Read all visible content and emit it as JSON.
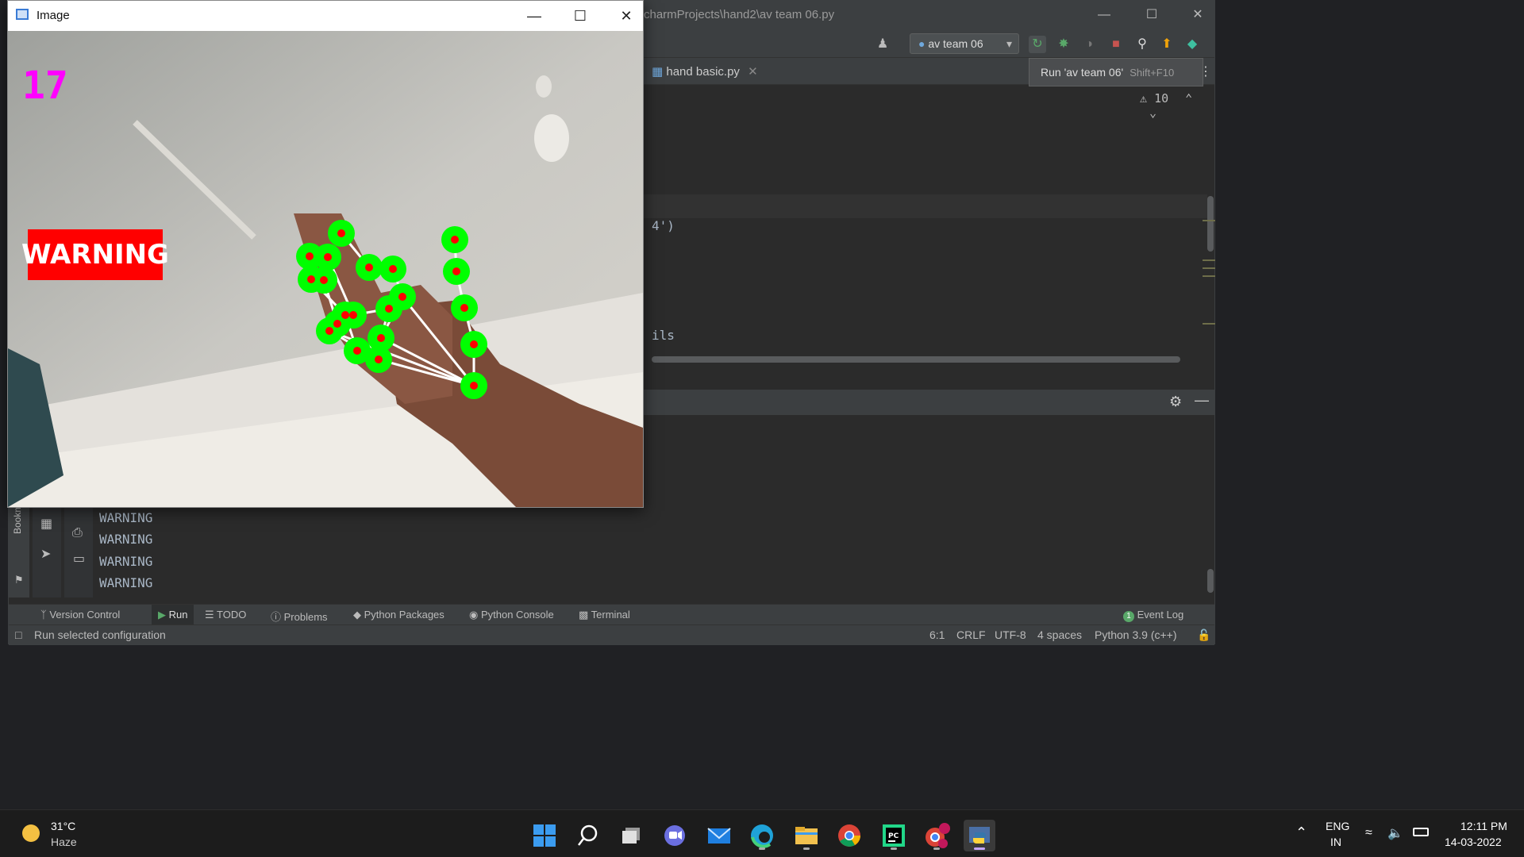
{
  "ide": {
    "title_text": "charmProjects\\hand2\\av team 06.py",
    "run_config": "av team 06",
    "file_tab": "hand basic.py",
    "tooltip_text": "Run 'av team 06'",
    "tooltip_shortcut": "Shift+F10",
    "inspection_count": "10",
    "code_fragments": [
      "4')",
      "ils"
    ],
    "console_lines": [
      "WARNING",
      "WARNING",
      "WARNING",
      "WARNING"
    ],
    "tool_tabs": [
      "Version Control",
      "Run",
      "TODO",
      "Problems",
      "Python Packages",
      "Python Console",
      "Terminal"
    ],
    "event_log": "Event Log",
    "event_log_count": "1",
    "bookmarks_label": "Bookmarks",
    "status": {
      "message": "Run selected configuration",
      "position": "6:1",
      "line_sep": "CRLF",
      "encoding": "UTF-8",
      "indent": "4 spaces",
      "interpreter": "Python 3.9 (c++)"
    }
  },
  "image_window": {
    "title": "Image",
    "fps": "17",
    "warning": "WARNING"
  },
  "taskbar": {
    "weather_temp": "31°C",
    "weather_desc": "Haze",
    "lang_primary": "ENG",
    "lang_secondary": "IN",
    "time": "12:11 PM",
    "date": "14-03-2022",
    "apps": [
      "start-icon",
      "search-icon",
      "task-view-icon",
      "chat-icon",
      "mail-icon",
      "edge-icon",
      "file-explorer-icon",
      "chrome-icon",
      "pycharm-icon",
      "chrome-profile-icon",
      "python-icon"
    ]
  },
  "colors": {
    "ide_bg": "#2b2b2b",
    "ide_panel": "#3c3f41",
    "landmark_green": "#00ff00",
    "landmark_red": "#ff0000",
    "fps_magenta": "#ff00ff",
    "warning_red": "#ff0000"
  }
}
